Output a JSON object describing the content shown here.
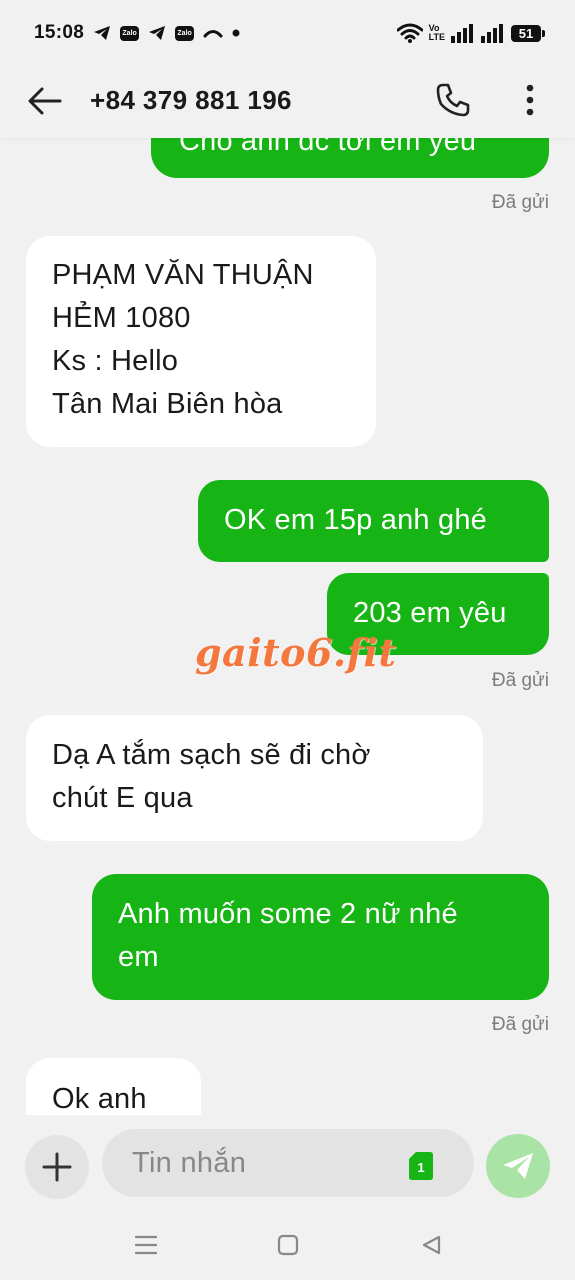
{
  "status_bar": {
    "time": "15:08",
    "zalo_badge_1": "Zalo",
    "zalo_badge_2": "Zalo",
    "volte_top": "Vo",
    "volte_bottom": "LTE",
    "battery": "51",
    "icons": [
      "telegram-icon",
      "zalo-icon",
      "telegram-icon",
      "zalo-icon",
      "missed-call-icon",
      "dot-icon",
      "wifi-icon",
      "signal-icon",
      "signal-icon",
      "battery-icon"
    ]
  },
  "header": {
    "title": "+84 379 881 196",
    "back_icon": "arrow-left-icon",
    "call_icon": "phone-icon",
    "more_icon": "more-vertical-icon"
  },
  "messages": [
    {
      "direction": "out",
      "text": "Cho anh đc tới em yêu"
    },
    {
      "direction": "in",
      "text": "PHẠM VĂN THUẬN\nHẺM 1080\nKs : Hello\nTân Mai Biên hòa"
    },
    {
      "direction": "out",
      "text": "OK em 15p anh ghé"
    },
    {
      "direction": "out",
      "text": "203 em yêu"
    },
    {
      "direction": "in",
      "text": "Dạ A tắm sạch sẽ đi chờ\nchút E qua"
    },
    {
      "direction": "out",
      "text": "Anh muốn some 2 nữ nhé\nem"
    },
    {
      "direction": "in",
      "text": "Ok anh"
    }
  ],
  "sent_labels": [
    "Đã gửi",
    "Đã gửi",
    "Đã gửi"
  ],
  "watermark": "gaito6.fit",
  "composer": {
    "placeholder": "Tin nhắn",
    "sim_slot": "1",
    "add_icon": "plus-icon",
    "send_icon": "send-icon"
  },
  "nav_bar": {
    "icons": [
      "menu-icon",
      "home-icon",
      "back-triangle-icon"
    ]
  },
  "colors": {
    "outgoing_bubble": "#16b515",
    "incoming_bubble": "#ffffff",
    "background": "#f1f1f1",
    "watermark": "#f4773d",
    "send_button": "#a9e3a6",
    "sim_badge": "#16b515"
  }
}
